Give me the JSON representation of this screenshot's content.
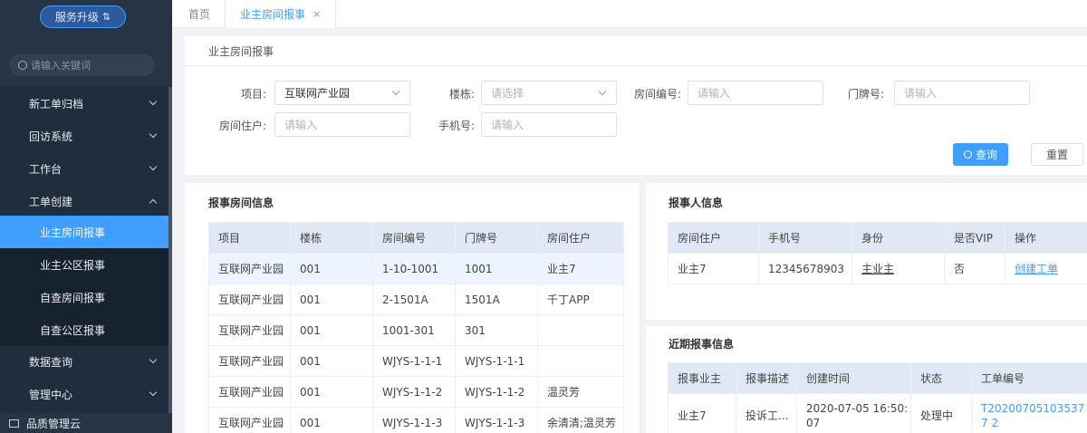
{
  "sidebar": {
    "upgrade_label": "服务升级",
    "upgrade_icon": "sort-icon",
    "search_placeholder": "请输入关键词",
    "menu": [
      {
        "label": "新工单归档"
      },
      {
        "label": "回访系统"
      },
      {
        "label": "工作台"
      },
      {
        "label": "工单创建"
      }
    ],
    "submenu": [
      {
        "label": "业主房间报事"
      },
      {
        "label": "业主公区报事"
      },
      {
        "label": "自查房间报事"
      },
      {
        "label": "自查公区报事"
      }
    ],
    "menu2": [
      {
        "label": "数据查询"
      },
      {
        "label": "管理中心"
      }
    ],
    "bottom_label": "品质管理云"
  },
  "tabs": {
    "home": "首页",
    "active": "业主房间报事",
    "close": "×"
  },
  "page": {
    "title": "业主房间报事"
  },
  "form": {
    "project_label": "项目:",
    "project_value": "互联网产业园",
    "building_label": "楼栋:",
    "building_placeholder": "请选择",
    "room_no_label": "房间编号:",
    "room_no_placeholder": "请输入",
    "door_label": "门牌号:",
    "door_placeholder": "请输入",
    "resident_label": "房间住户:",
    "resident_placeholder": "请输入",
    "phone_label": "手机号:",
    "phone_placeholder": "请输入",
    "query_label": "查询",
    "reset_label": "重置"
  },
  "rooms": {
    "title": "报事房间信息",
    "headers": [
      "项目",
      "楼栋",
      "房间编号",
      "门牌号",
      "房间住户"
    ],
    "rows": [
      [
        "互联网产业园",
        "001",
        "1-10-1001",
        "1001",
        "业主7"
      ],
      [
        "互联网产业园",
        "001",
        "2-1501A",
        "1501A",
        "千丁APP"
      ],
      [
        "互联网产业园",
        "001",
        "1001-301",
        "301",
        ""
      ],
      [
        "互联网产业园",
        "001",
        "WJYS-1-1-1",
        "WJYS-1-1-1",
        ""
      ],
      [
        "互联网产业园",
        "001",
        "WJYS-1-1-2",
        "WJYS-1-1-2",
        "温灵芳"
      ],
      [
        "互联网产业园",
        "001",
        "WJYS-1-1-3",
        "WJYS-1-1-3",
        "余清清;温灵芳"
      ]
    ]
  },
  "reporter": {
    "title": "报事人信息",
    "headers": [
      "房间住户",
      "手机号",
      "身份",
      "是否VIP",
      "操作"
    ],
    "row": [
      "业主7",
      "12345678903",
      "主业主",
      "否",
      "创建工单"
    ]
  },
  "recent": {
    "title": "近期报事信息",
    "headers": [
      "报事业主",
      "报事描述",
      "创建时间",
      "状态",
      "工单编号"
    ],
    "row": [
      "业主7",
      "投诉工...",
      "2020-07-05 16:50:07",
      "处理中",
      "T202007051035377 2"
    ]
  },
  "colors": {
    "accent": "#409eff",
    "sidebar_bg": "#1f2d3d"
  }
}
